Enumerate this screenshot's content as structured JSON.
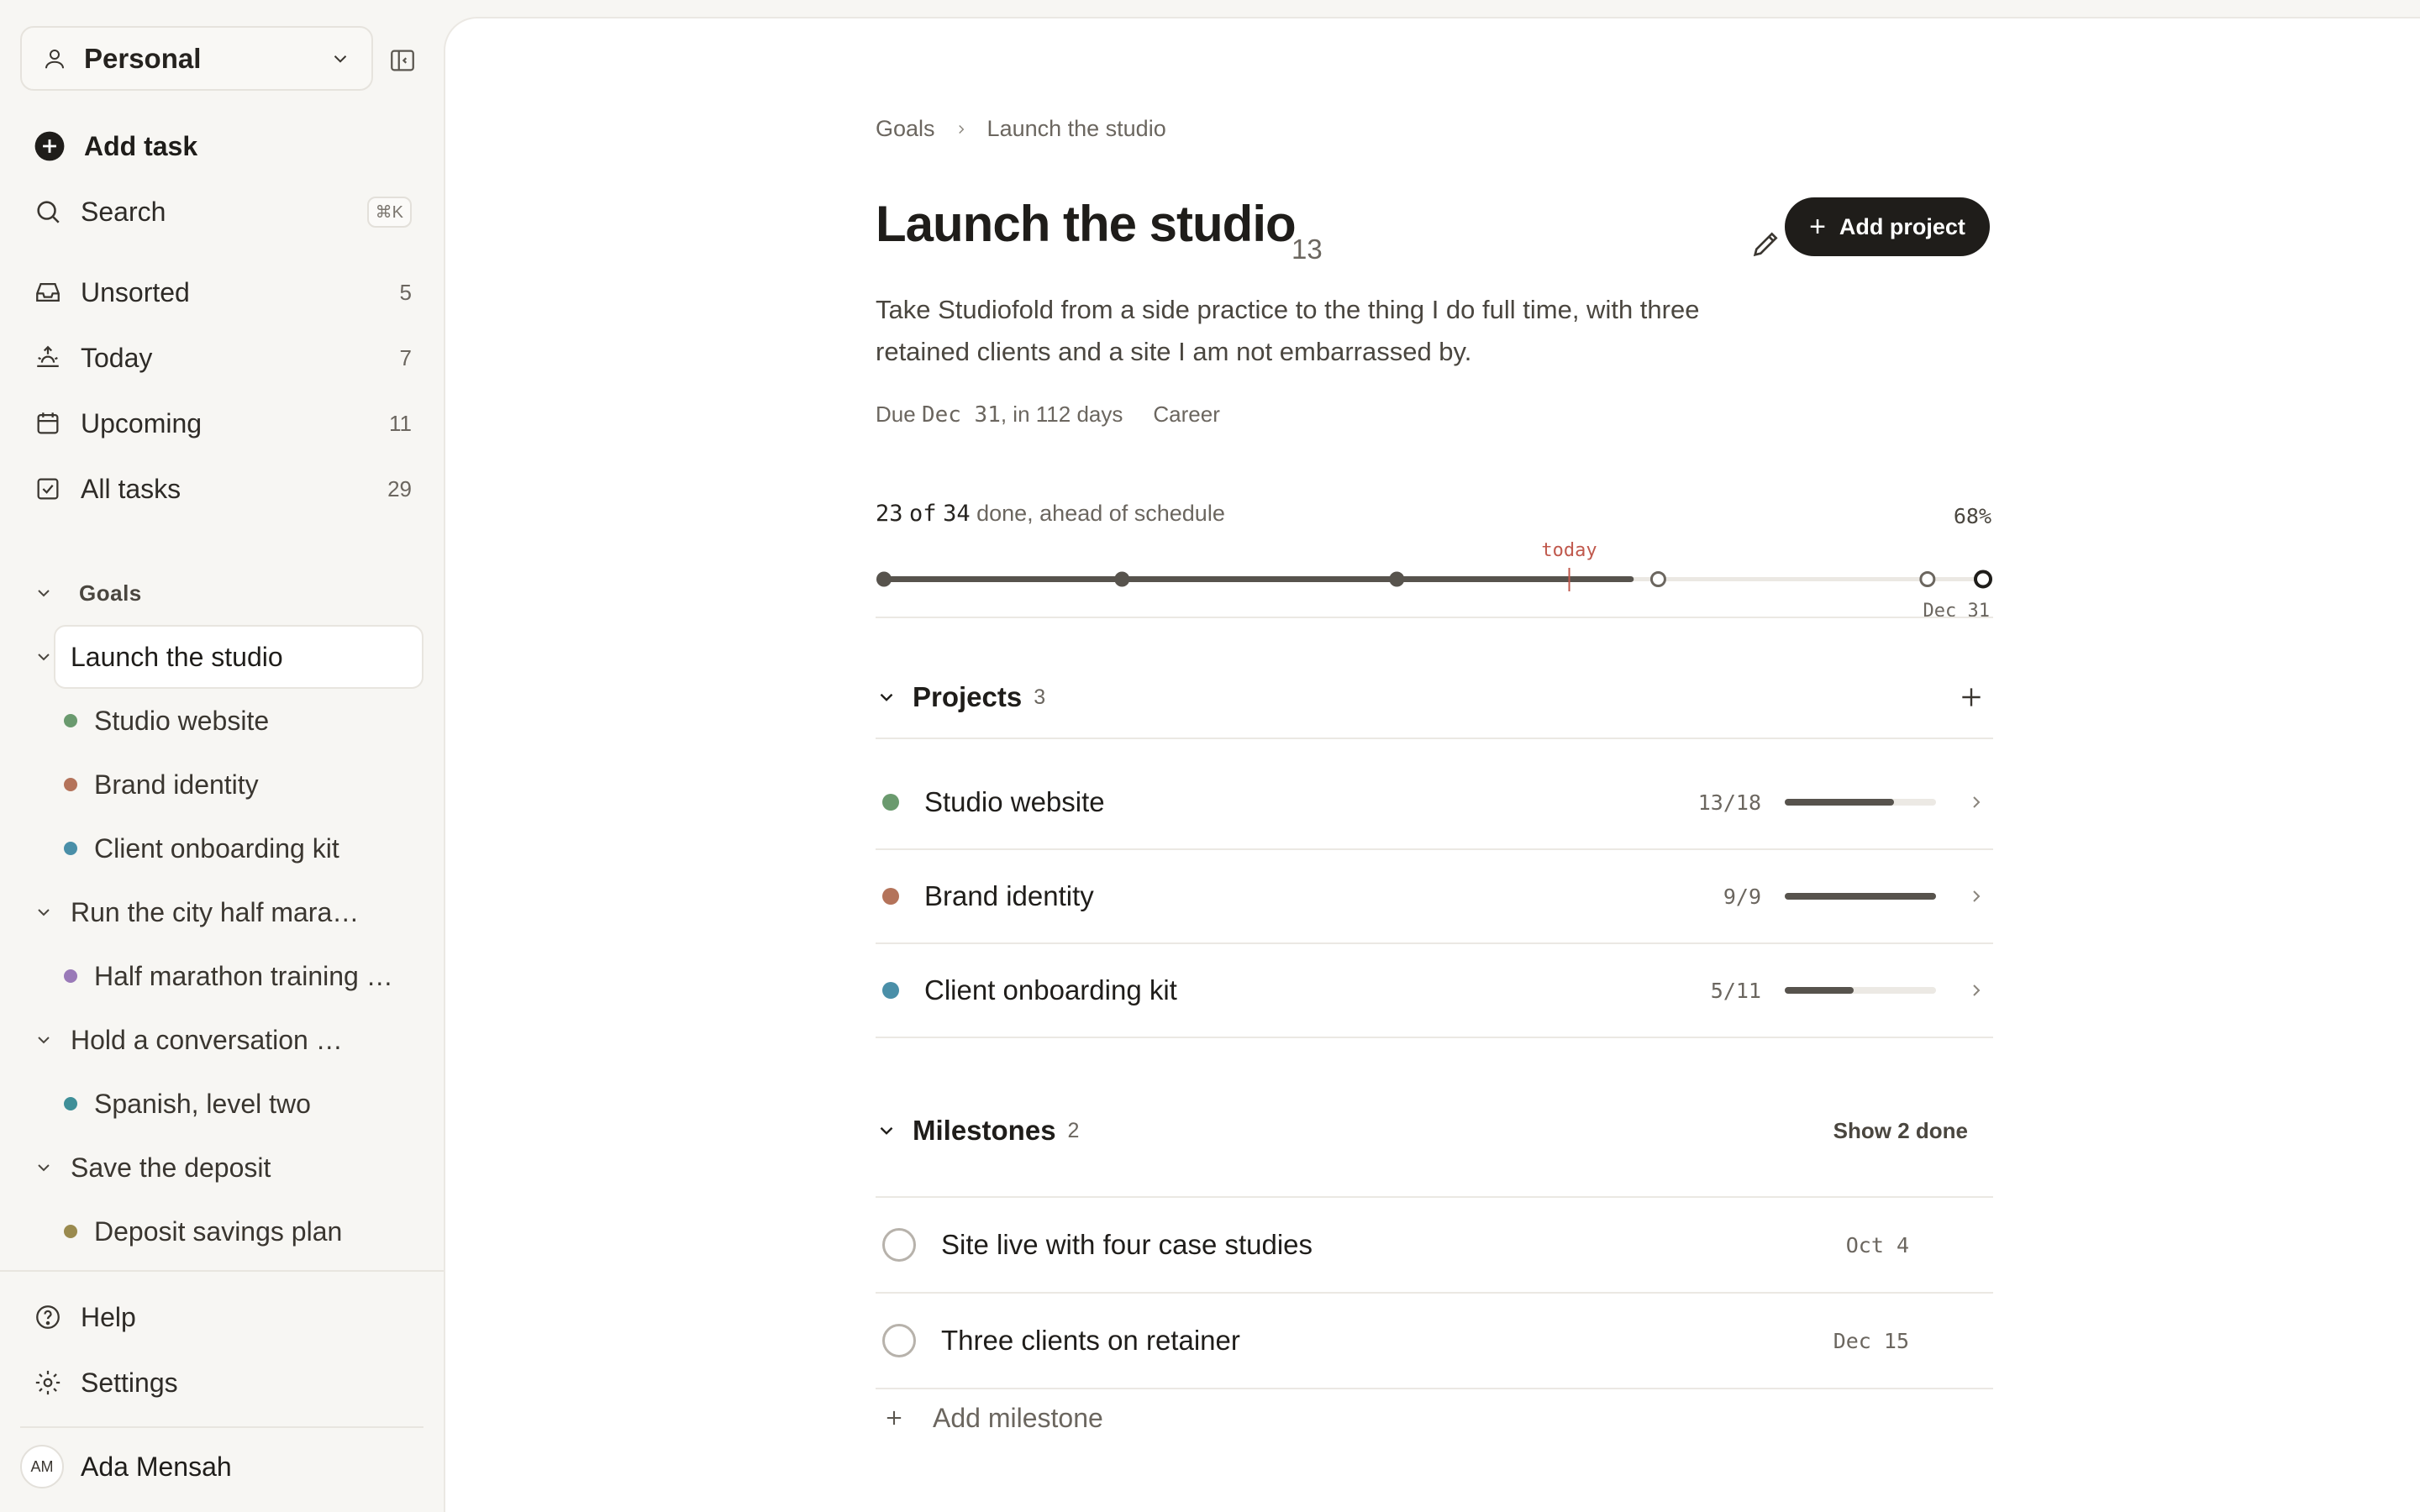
{
  "sidebar": {
    "workspace": "Personal",
    "add_task": "Add task",
    "search": {
      "label": "Search",
      "shortcut": "⌘K"
    },
    "nav": [
      {
        "label": "Unsorted",
        "count": "5"
      },
      {
        "label": "Today",
        "count": "7"
      },
      {
        "label": "Upcoming",
        "count": "11"
      },
      {
        "label": "All tasks",
        "count": "29"
      }
    ],
    "goals_heading": "Goals",
    "goals": [
      {
        "label": "Launch the studio"
      },
      {
        "label": "Run the city half marathon"
      },
      {
        "label": "Hold a conversation in Spanish"
      },
      {
        "label": "Save the deposit"
      }
    ],
    "projects": [
      {
        "label": "Studio website",
        "color": "#6a9a6e"
      },
      {
        "label": "Brand identity",
        "color": "#b4735a"
      },
      {
        "label": "Client onboarding kit",
        "color": "#4a8fa8"
      },
      {
        "label": "Half marathon training plan",
        "color": "#9a7ab8"
      },
      {
        "label": "Spanish, level two",
        "color": "#3f8f98"
      },
      {
        "label": "Deposit savings plan",
        "color": "#9a8a4e"
      }
    ],
    "help": "Help",
    "settings": "Settings",
    "user": {
      "initials": "AM",
      "name": "Ada Mensah"
    }
  },
  "main": {
    "breadcrumb": [
      "Goals",
      "Launch the studio"
    ],
    "title": "Launch the studio",
    "title_count": "13",
    "add_project": "Add project",
    "description": "Take Studiofold from a side practice to the thing I do full time, with three retained clients and a site I am not embarrassed by.",
    "due_prefix": "Due",
    "due_date": "Dec 31",
    "due_suffix": ", in 112 days",
    "area": "Career",
    "progress": {
      "done": "23",
      "of_word": "of",
      "total": "34",
      "status": "done, ahead of schedule",
      "percent": "68%",
      "fraction": 0.68,
      "today_label": "today",
      "today_fraction": 0.622,
      "end_label": "Dec 31",
      "milestone_fractions_done": [
        0,
        0.22,
        0.467
      ],
      "milestone_fractions_open": [
        0.702,
        0.944,
        1.0
      ]
    },
    "projects_heading": "Projects",
    "projects_count": "3",
    "projects": [
      {
        "label": "Studio website",
        "ratio": "13/18",
        "fraction": 0.722,
        "color": "#6a9a6e"
      },
      {
        "label": "Brand identity",
        "ratio": "9/9",
        "fraction": 1.0,
        "color": "#b4735a"
      },
      {
        "label": "Client onboarding kit",
        "ratio": "5/11",
        "fraction": 0.4545,
        "color": "#4a8fa8"
      }
    ],
    "milestones_heading": "Milestones",
    "milestones_count": "2",
    "show_done": "Show 2 done",
    "milestones": [
      {
        "label": "Site live with four case studies",
        "date": "Oct 4"
      },
      {
        "label": "Three clients on retainer",
        "date": "Dec 15"
      }
    ],
    "add_milestone": "Add milestone"
  }
}
